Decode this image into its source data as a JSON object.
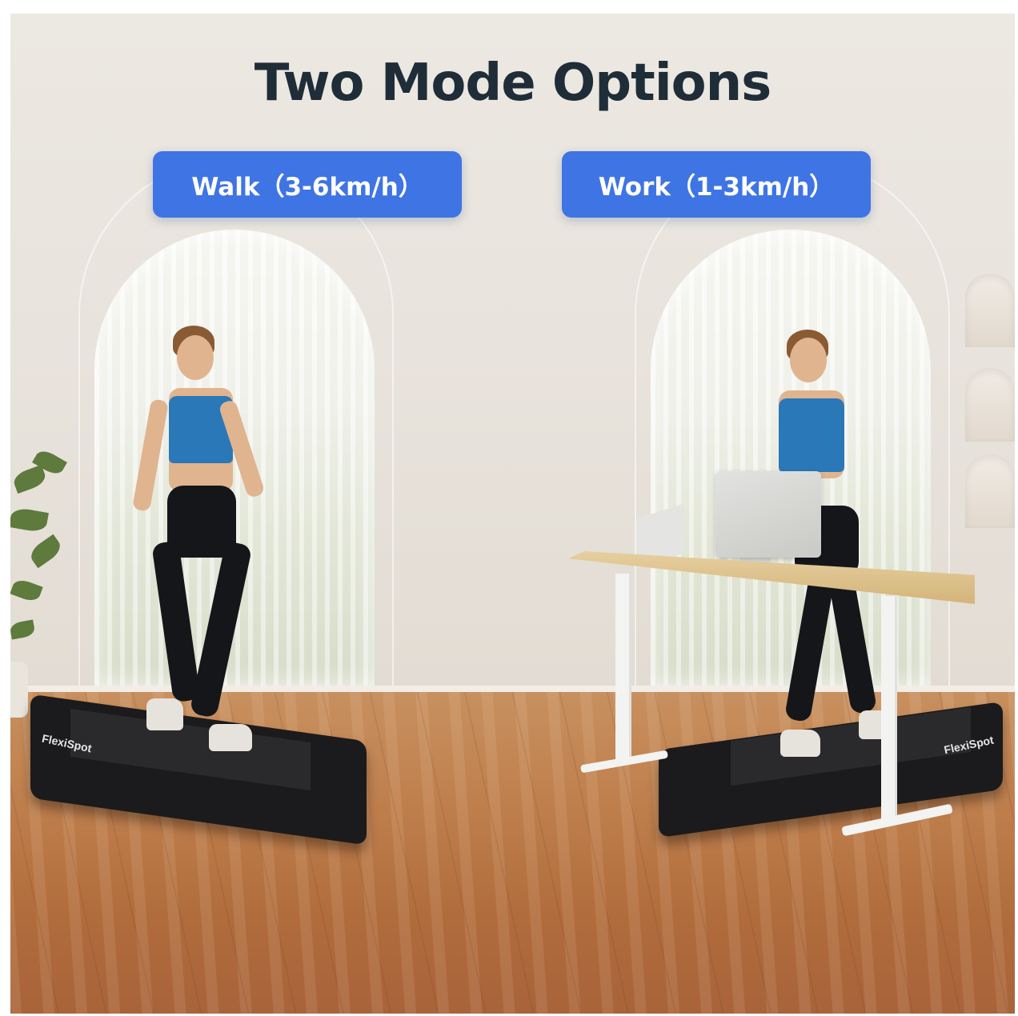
{
  "title": "Two Mode Options",
  "modes": [
    {
      "label": "Walk（3-6km/h）"
    },
    {
      "label": "Work（1-3km/h）"
    }
  ],
  "brand": "FlexiSpot",
  "colors": {
    "title": "#1f2d38",
    "badge_background": "#3f74e4",
    "badge_text": "#ffffff"
  }
}
